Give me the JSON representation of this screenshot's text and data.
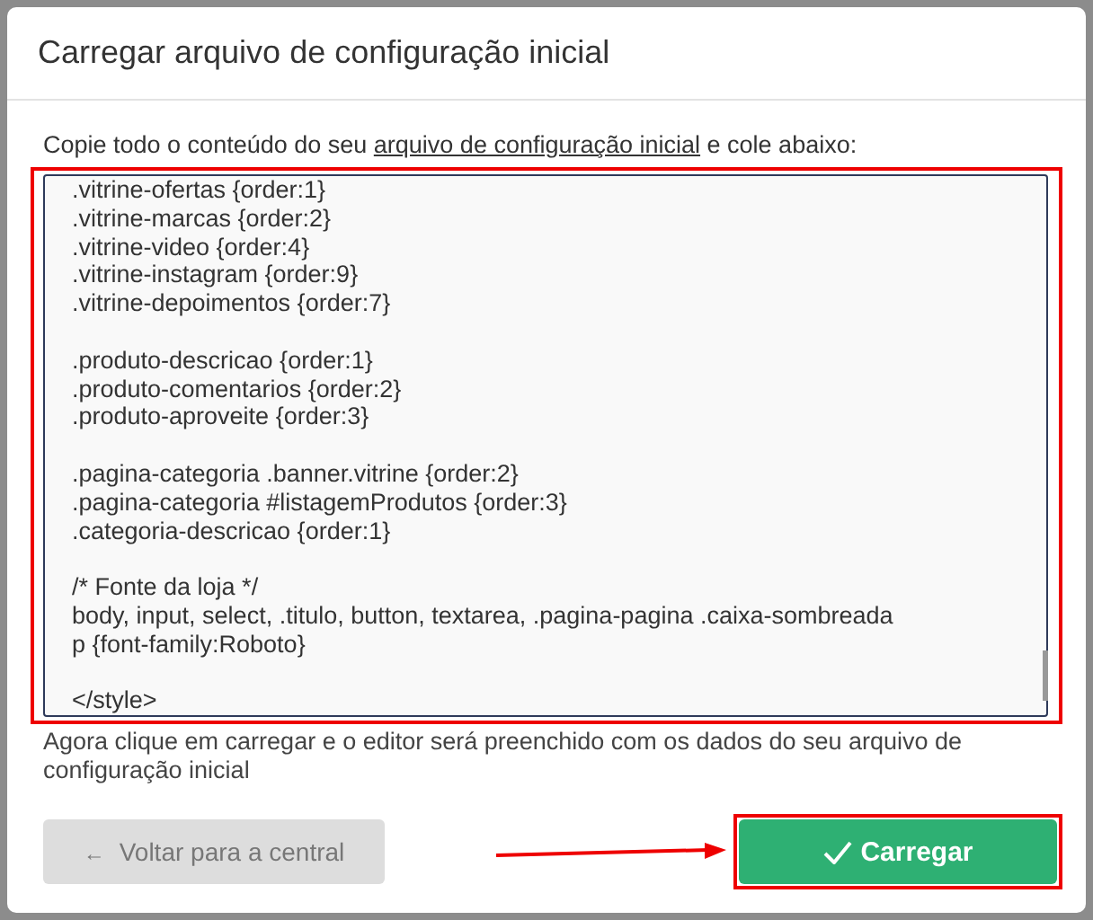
{
  "dialog": {
    "title": "Carregar arquivo de configuração inicial",
    "instruction": {
      "before": "Copie todo o conteúdo do seu ",
      "link": "arquivo de configuração inicial",
      "after": " e cole abaixo:"
    },
    "textarea": {
      "blocks": [
        [
          ".vitrine-ofertas {order:1}",
          ".vitrine-marcas {order:2}",
          ".vitrine-video {order:4}",
          ".vitrine-instagram {order:9}",
          ".vitrine-depoimentos {order:7}"
        ],
        [
          ".produto-descricao {order:1}",
          ".produto-comentarios {order:2}",
          ".produto-aproveite {order:3}"
        ],
        [
          ".pagina-categoria .banner.vitrine {order:2}",
          ".pagina-categoria #listagemProdutos {order:3}",
          ".categoria-descricao {order:1}"
        ],
        [
          "/* Fonte da loja */",
          "body, input, select, .titulo, button, textarea, .pagina-pagina .caixa-sombreada p {font-family:Roboto}"
        ],
        [
          "</style>"
        ]
      ]
    },
    "hint": "Agora clique em carregar e o editor será preenchido com os dados do seu arquivo de configuração inicial",
    "buttons": [
      {
        "kind": "back",
        "icon": "←",
        "label": "Voltar para a central"
      },
      {
        "kind": "primary",
        "label": "Carregar"
      }
    ],
    "annotations": {
      "highlight_textarea": true,
      "highlight_load_button": true,
      "arrow": true
    }
  }
}
